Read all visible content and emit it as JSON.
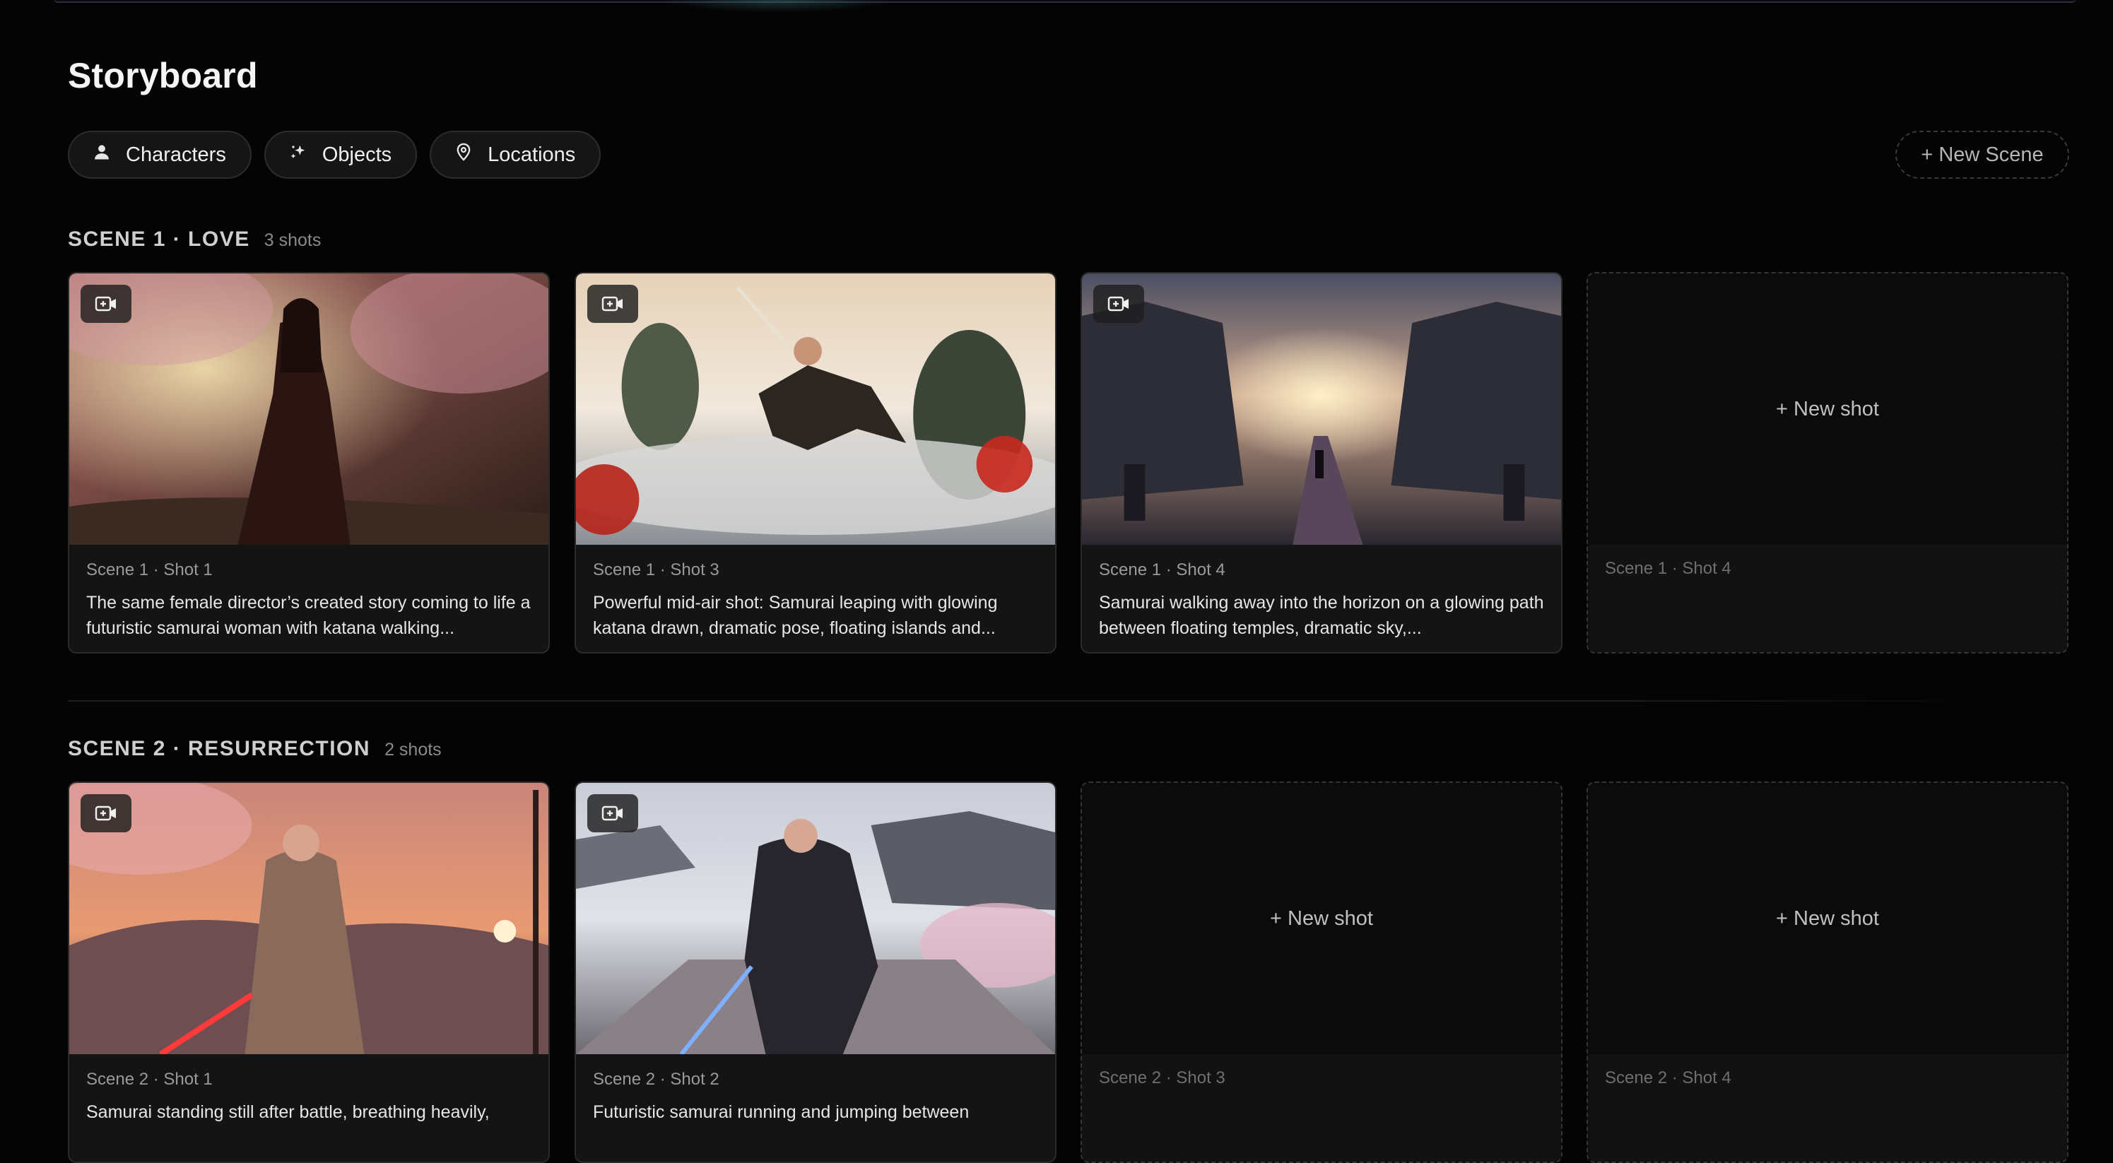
{
  "page": {
    "title": "Storyboard"
  },
  "toolbar": {
    "chips": [
      {
        "label": "Characters",
        "icon": "person-icon"
      },
      {
        "label": "Objects",
        "icon": "sparkles-icon"
      },
      {
        "label": "Locations",
        "icon": "map-pin-icon"
      }
    ],
    "new_scene_label": "+ New Scene"
  },
  "scenes": [
    {
      "title": "SCENE 1 · LOVE",
      "count": "3 shots",
      "shots": [
        {
          "label": "Scene 1 · Shot 1",
          "desc": "The same female director’s created story coming to life a futuristic samurai woman with katana walking..."
        },
        {
          "label": "Scene 1 · Shot 3",
          "desc": "Powerful mid-air shot: Samurai leaping with glowing katana drawn, dramatic pose, floating islands and..."
        },
        {
          "label": "Scene 1 · Shot 4",
          "desc": "Samurai walking away into the horizon on a glowing path between floating temples, dramatic sky,..."
        },
        {
          "empty": true,
          "new_label": "+ New shot",
          "label": "Scene 1 · Shot 4"
        }
      ]
    },
    {
      "title": "SCENE 2 · RESURRECTION",
      "count": "2 shots",
      "shots": [
        {
          "label": "Scene 2 · Shot 1",
          "desc": "Samurai standing still after battle, breathing heavily,"
        },
        {
          "label": "Scene 2 · Shot 2",
          "desc": "Futuristic samurai running and jumping between"
        },
        {
          "empty": true,
          "new_label": "+ New shot",
          "label": "Scene 2 · Shot 3"
        },
        {
          "empty": true,
          "new_label": "+ New shot",
          "label": "Scene 2 · Shot 4"
        }
      ]
    }
  ],
  "icons": {
    "video_badge": "video-add-icon"
  },
  "colors": {
    "background": "#040404",
    "card": "#141414",
    "border": "#2a2a2a"
  }
}
